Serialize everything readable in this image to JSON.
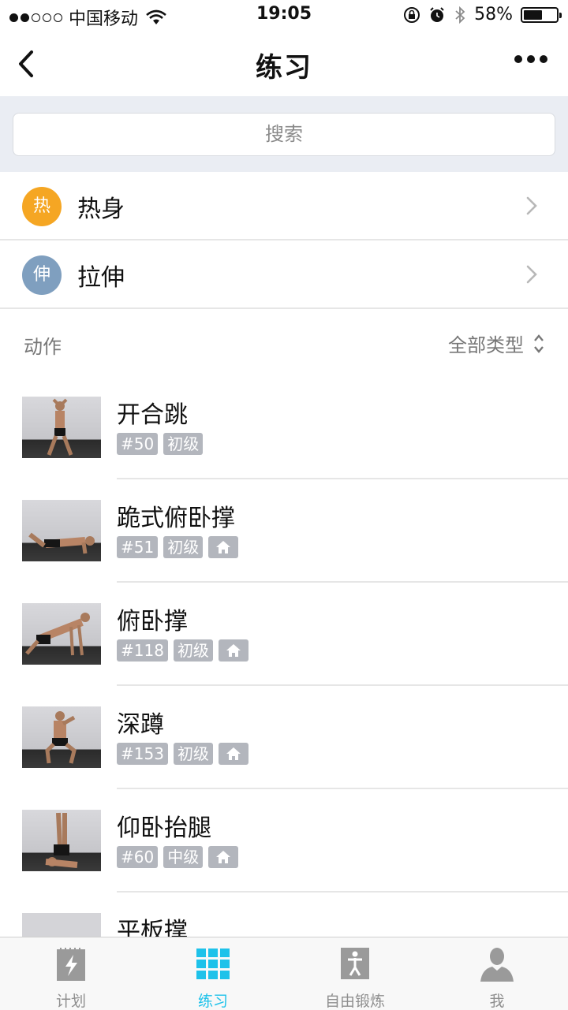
{
  "status": {
    "carrier": "中国移动",
    "time": "19:05",
    "battery_pct": "58%",
    "battery_level": 0.58
  },
  "nav": {
    "title": "练习"
  },
  "search": {
    "placeholder": "搜索"
  },
  "categories": [
    {
      "badge": "热",
      "label": "热身",
      "color": "#f5a623"
    },
    {
      "badge": "伸",
      "label": "拉伸",
      "color": "#7f9fbf"
    }
  ],
  "section": {
    "title": "动作",
    "filter_label": "全部类型"
  },
  "exercises": [
    {
      "name": "开合跳",
      "number": "#50",
      "level": "初级",
      "home": false
    },
    {
      "name": "跪式俯卧撑",
      "number": "#51",
      "level": "初级",
      "home": true
    },
    {
      "name": "俯卧撑",
      "number": "#118",
      "level": "初级",
      "home": true
    },
    {
      "name": "深蹲",
      "number": "#153",
      "level": "初级",
      "home": true
    },
    {
      "name": "仰卧抬腿",
      "number": "#60",
      "level": "中级",
      "home": true
    },
    {
      "name": "平板撑"
    }
  ],
  "tabs": [
    {
      "label": "计划",
      "icon": "plan-icon"
    },
    {
      "label": "练习",
      "icon": "grid-icon"
    },
    {
      "label": "自由锻炼",
      "icon": "person-icon"
    },
    {
      "label": "我",
      "icon": "user-icon"
    }
  ],
  "colors": {
    "accent": "#1ec2ea",
    "tag_bg": "#b3b6bd",
    "search_bg": "#eaedf3"
  }
}
